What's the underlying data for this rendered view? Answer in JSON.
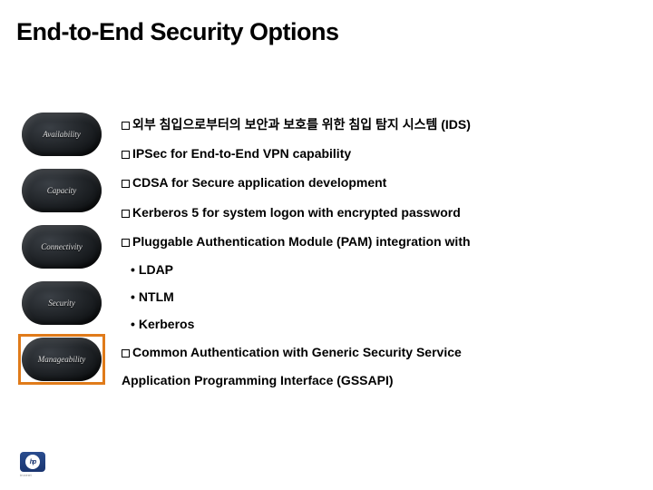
{
  "title": "End-to-End Security Options",
  "sidebar": {
    "items": [
      {
        "label": "Availability"
      },
      {
        "label": "Capacity"
      },
      {
        "label": "Connectivity"
      },
      {
        "label": "Security"
      },
      {
        "label": "Manageability"
      }
    ],
    "highlight_index": 3
  },
  "content": {
    "bullets": [
      "외부 침입으로부터의 보안과 보호를 위한 침입 탐지 시스템 (IDS)",
      "IPSec for End-to-End VPN capability",
      "CDSA  for Secure application development",
      "Kerberos 5 for system logon with encrypted password",
      "Pluggable Authentication Module (PAM) integration with"
    ],
    "sub_bullets": [
      "LDAP",
      "NTLM",
      "Kerberos"
    ],
    "bullet_tail": "Common Authentication with Generic Security Service",
    "bullet_tail2": "Application Programming Interface (GSSAPI)"
  },
  "logo": {
    "text": "hp",
    "sub": "invent"
  }
}
